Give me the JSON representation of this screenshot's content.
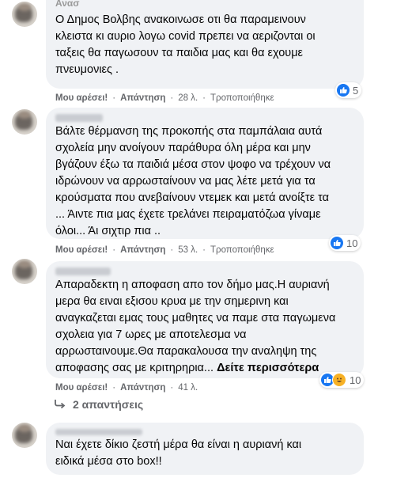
{
  "comments": [
    {
      "text": "Ο Δημος Βολβης ανακοινωσε οτι θα παραμεινουν\nκλειστα κι αυριο λογω covid πρεπει να αεριζονται οι\nταξεις θα παγωσουν τα παιδια μας και θα εχουμε\nπνευμονιες .",
      "name_partial": "Ανασ",
      "like_label": "Μου αρέσει!",
      "reply_label": "Απάντηση",
      "time": "28 λ.",
      "edited": "Τροποποιήθηκε",
      "reactions": "5"
    },
    {
      "text": "Βάλτε θέρμανση της προκοπής στα παμπάλαια αυτά\nσχολεία μην ανοίγουν παράθυρα όλη μέρα και μην\nβγάζουν έξω τα παιδιά μέσα στον ψοφο να τρέχουν να\nιδρώνουν να αρρωσταίνουν να μας λέτε μετά για τα\nκρούσματα που ανεβαίνουν ντεμεκ και μετά ανοίξτε τα\n... Άιντε πια μας έχετε τρελάνει πειραματόζωα γίναμε\nόλοι... Άι σιχτιρ πια ..",
      "like_label": "Μου αρέσει!",
      "reply_label": "Απάντηση",
      "time": "53 λ.",
      "edited": "Τροποποιήθηκε",
      "reactions": "10"
    },
    {
      "text": "Απαραδεκτη η αποφαση απο τον δήμο μας.Η αυριανή\nμερα θα ειναι εξισου κρυα με την σημερινη και\nαναγκαζεται εμας τους μαθητες να παμε στα παγωμενα\nσχολεια για 7 ωρες με αποτελεσμα να\nαρρωσταινουμε.Θα παρακαλουσα την αναληψη της\nαποφασης σας με κριτηρηρια... ",
      "see_more": "Δείτε περισσότερα",
      "like_label": "Μου αρέσει!",
      "reply_label": "Απάντηση",
      "time": "41 λ.",
      "reactions": "10"
    },
    {
      "text": "Ναι έχετε δίκιο ζεστή μέρα θα είναι η αυριανή και\nειδικά μέσα στο box!!"
    }
  ],
  "replies_link": "2 απαντήσεις",
  "colors": {
    "bubble": "#f0f2f5",
    "like": "#1877f2",
    "meta": "#65676b"
  },
  "icons": [
    "like-icon",
    "haha-icon",
    "reply-arrow-icon"
  ]
}
